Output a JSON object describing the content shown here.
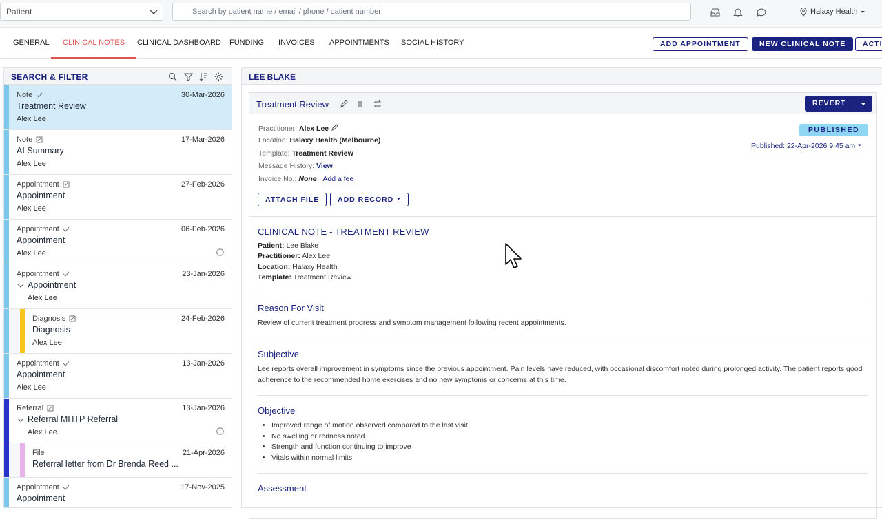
{
  "topbar": {
    "patient_select": "Patient",
    "search_placeholder": "Search by patient name / email / phone / patient number",
    "org_name": "Halaxy Health"
  },
  "tabs": [
    "GENERAL",
    "CLINICAL NOTES",
    "CLINICAL DASHBOARD",
    "FUNDING",
    "INVOICES",
    "APPOINTMENTS",
    "SOCIAL HISTORY"
  ],
  "active_tab": "CLINICAL NOTES",
  "actions": {
    "add_appointment": "ADD APPOINTMENT",
    "new_clinical_note": "NEW CLINICAL NOTE",
    "actions_truncated": "ACTI"
  },
  "left_panel": {
    "title": "SEARCH & FILTER",
    "items": [
      {
        "type": "Note",
        "date": "30-Mar-2026",
        "title": "Treatment Review",
        "by": "Alex Lee",
        "color": "#7cc8ec"
      },
      {
        "type": "Note",
        "date": "17-Mar-2026",
        "title": "AI Summary",
        "by": "Alex Lee",
        "color": "#7cc8ec"
      },
      {
        "type": "Appointment",
        "date": "27-Feb-2026",
        "title": "Appointment",
        "by": "Alex Lee",
        "color": "#7cc8ec"
      },
      {
        "type": "Appointment",
        "date": "06-Feb-2026",
        "title": "Appointment",
        "by": "Alex Lee",
        "color": "#7cc8ec"
      },
      {
        "type": "Appointment",
        "date": "23-Jan-2026",
        "title": "Appointment",
        "by": "Alex Lee",
        "color": "#7cc8ec"
      },
      {
        "type": "Diagnosis",
        "date": "24-Feb-2026",
        "title": "Diagnosis",
        "by": "Alex Lee",
        "color": "#f5c518"
      },
      {
        "type": "Appointment",
        "date": "13-Jan-2026",
        "title": "Appointment",
        "by": "Alex Lee",
        "color": "#7cc8ec"
      },
      {
        "type": "Referral",
        "date": "13-Jan-2026",
        "title": "Referral MHTP Referral",
        "by": "Alex Lee",
        "color": "#2634c9"
      },
      {
        "type": "File",
        "date": "21-Apr-2026",
        "title": "Referral letter from Dr Brenda Reed ...",
        "by": "",
        "color": "#e7b3ea"
      },
      {
        "type": "Appointment",
        "date": "17-Nov-2025",
        "title": "Appointment",
        "by": "",
        "color": "#7cc8ec"
      }
    ]
  },
  "right_panel": {
    "patient_name": "LEE BLAKE",
    "note_title": "Treatment Review",
    "revert": "REVERT",
    "status": "PUBLISHED",
    "published": "Published: 22-Apr-2026 9:45 am",
    "meta": {
      "practitioner_label": "Practitioner:",
      "practitioner": "Alex Lee",
      "location_label": "Location:",
      "location": "Halaxy Health (Melbourne)",
      "template_label": "Template:",
      "template": "Treatment Review",
      "history_label": "Message History:",
      "history_link": "View",
      "invoice_label": "Invoice No.:",
      "invoice": "None",
      "fee_link": "Add a fee"
    },
    "attach_file": "ATTACH FILE",
    "add_record": "ADD RECORD",
    "body": {
      "heading": "CLINICAL NOTE - TREATMENT REVIEW",
      "patient_label": "Patient:",
      "patient": "Lee Blake",
      "practitioner_label": "Practitioner:",
      "practitioner": "Alex Lee",
      "location_label": "Location:",
      "location": "Halaxy Health",
      "template_label": "Template:",
      "template": "Treatment Review",
      "reason_heading": "Reason For Visit",
      "reason_text": "Review of current treatment progress and symptom management following recent appointments.",
      "subjective_heading": "Subjective",
      "subjective_text": "Lee reports overall improvement in symptoms since the previous appointment. Pain levels have reduced, with occasional discomfort noted during prolonged activity. The patient reports good adherence to the recommended home exercises and no new symptoms or concerns at this time.",
      "objective_heading": "Objective",
      "objective_items": [
        "Improved range of motion observed compared to the last visit",
        "No swelling or redness noted",
        "Strength and function continuing to improve",
        "Vitals within normal limits"
      ],
      "assessment_heading": "Assessment"
    }
  }
}
